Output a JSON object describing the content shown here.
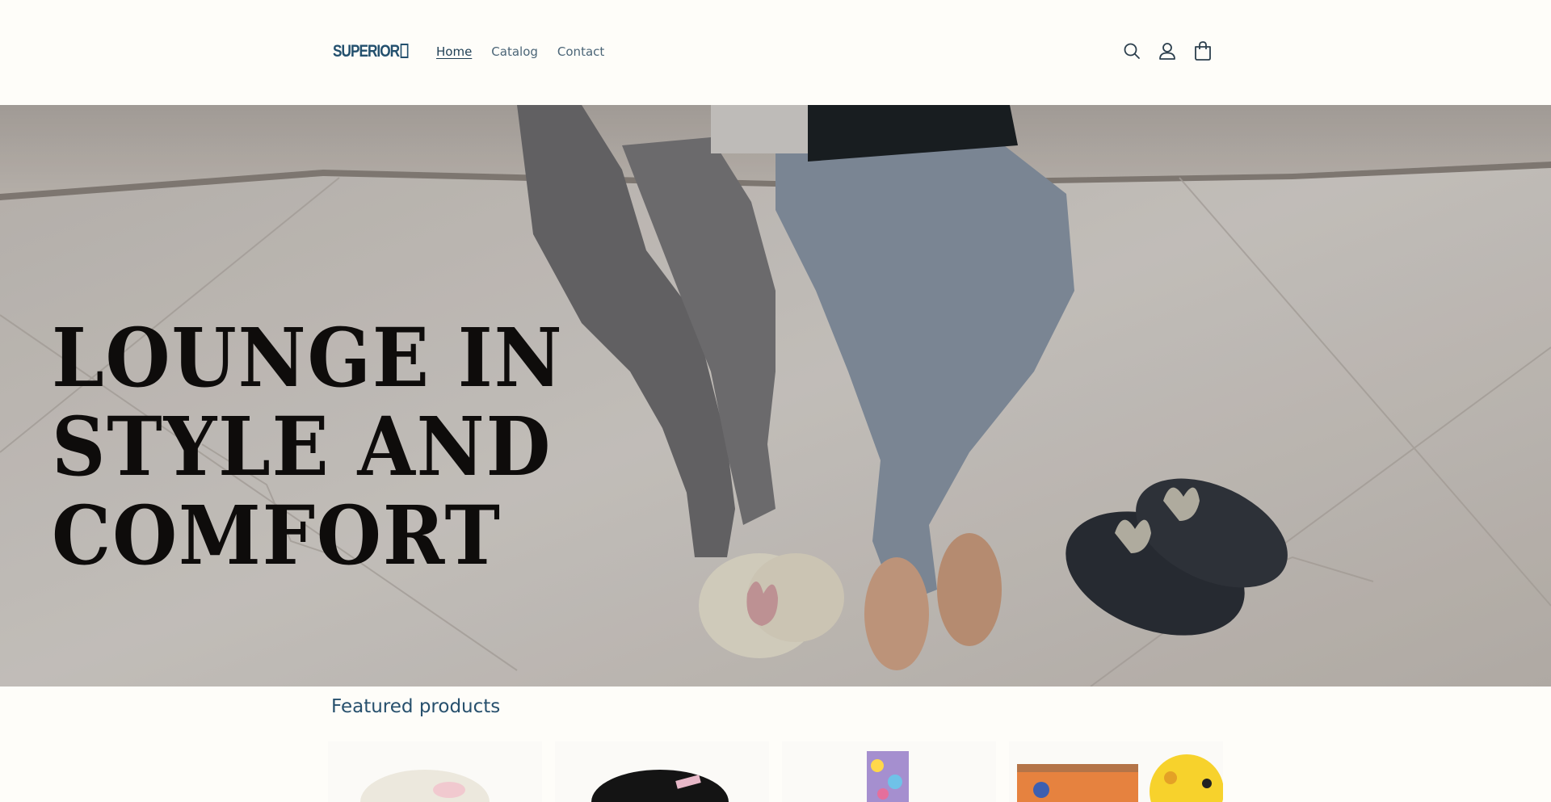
{
  "header": {
    "logo_text": "SUPERIOR",
    "nav": [
      {
        "label": "Home",
        "active": true
      },
      {
        "label": "Catalog",
        "active": false
      },
      {
        "label": "Contact",
        "active": false
      }
    ],
    "icons": [
      "search-icon",
      "account-icon",
      "cart-icon"
    ]
  },
  "hero": {
    "headline_lines": [
      "LOUNGE IN",
      "STYLE AND",
      "COMFORT"
    ]
  },
  "featured": {
    "title": "Featured products"
  },
  "colors": {
    "background": "#fefdf9",
    "brand": "#23506e",
    "text": "#4b6577"
  }
}
